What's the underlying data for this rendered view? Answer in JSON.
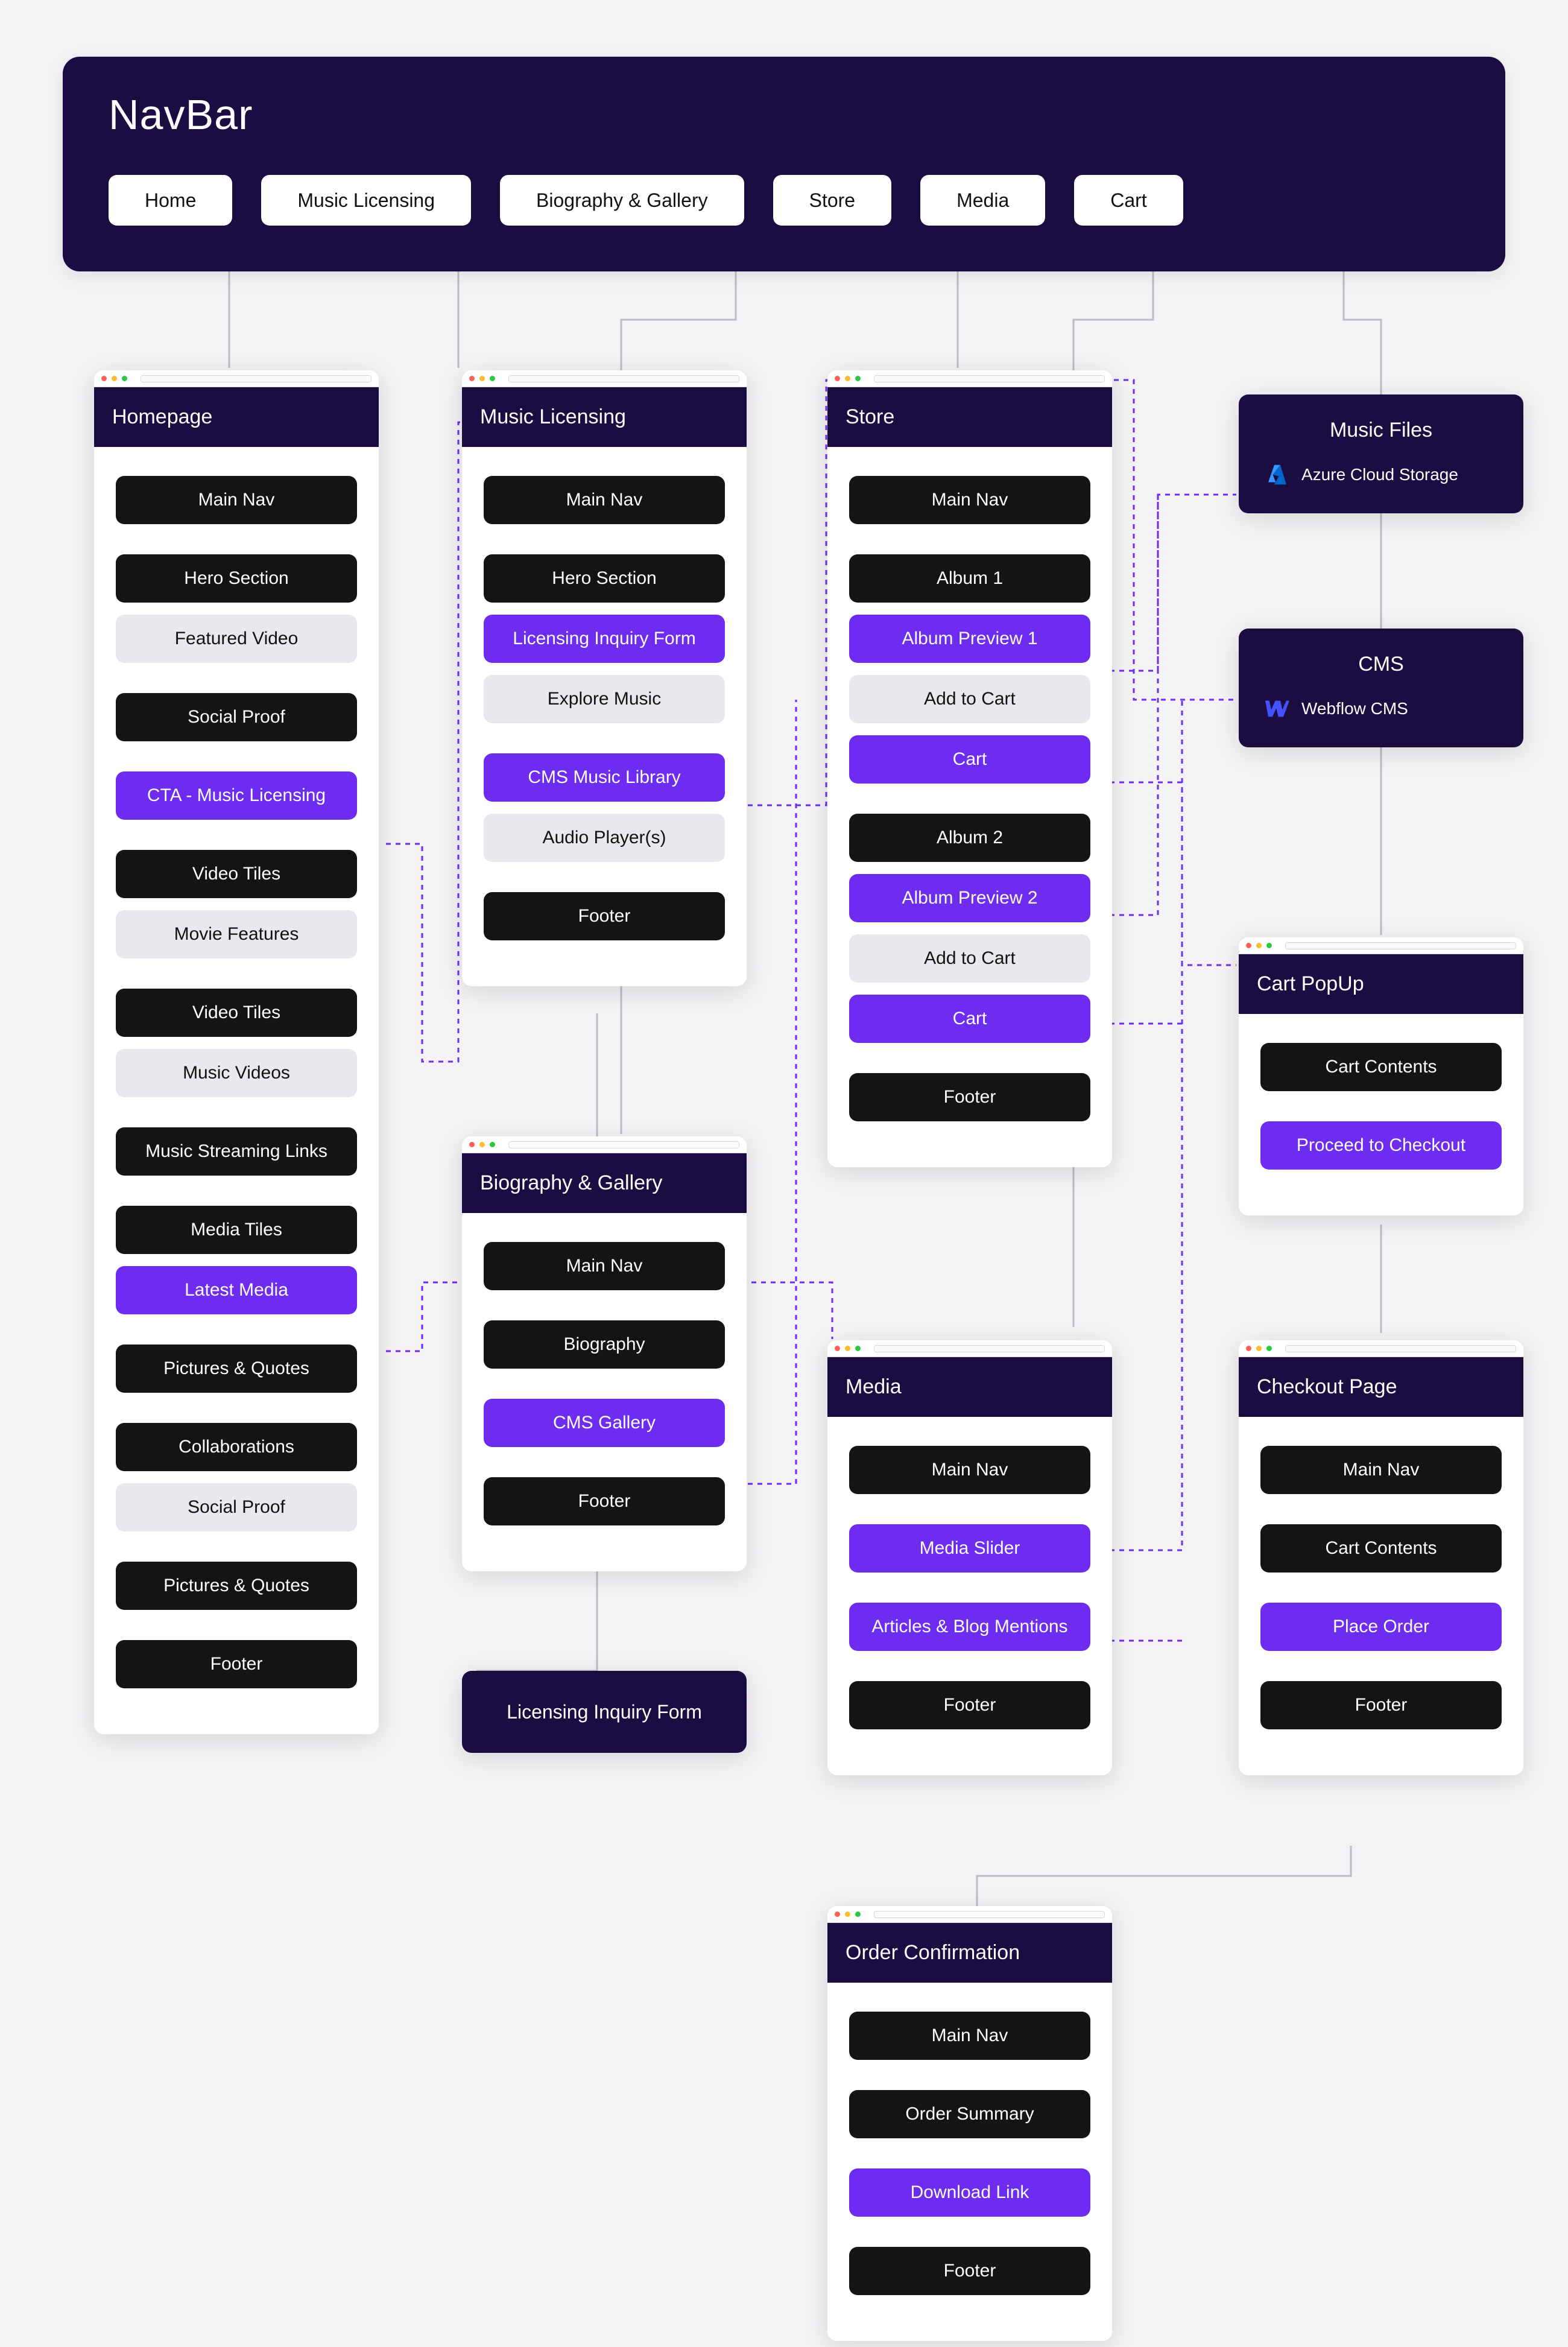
{
  "navbar": {
    "title": "NavBar",
    "items": [
      "Home",
      "Music Licensing",
      "Biography & Gallery",
      "Store",
      "Media",
      "Cart"
    ]
  },
  "homepage": {
    "title": "Homepage",
    "segments": [
      {
        "label": "Main Nav",
        "style": "black"
      },
      {
        "spacer": true
      },
      {
        "label": "Hero Section",
        "style": "black"
      },
      {
        "label": "Featured Video",
        "style": "gray"
      },
      {
        "spacer": true
      },
      {
        "label": "Social Proof",
        "style": "black"
      },
      {
        "spacer": true
      },
      {
        "label": "CTA - Music Licensing",
        "style": "purple"
      },
      {
        "spacer": true
      },
      {
        "label": "Video Tiles",
        "style": "black"
      },
      {
        "label": "Movie Features",
        "style": "gray"
      },
      {
        "spacer": true
      },
      {
        "label": "Video Tiles",
        "style": "black"
      },
      {
        "label": "Music Videos",
        "style": "gray"
      },
      {
        "spacer": true
      },
      {
        "label": "Music Streaming Links",
        "style": "black"
      },
      {
        "spacer": true
      },
      {
        "label": "Media Tiles",
        "style": "black"
      },
      {
        "label": "Latest Media",
        "style": "purple"
      },
      {
        "spacer": true
      },
      {
        "label": "Pictures & Quotes",
        "style": "black"
      },
      {
        "spacer": true
      },
      {
        "label": "Collaborations",
        "style": "black"
      },
      {
        "label": "Social Proof",
        "style": "gray"
      },
      {
        "spacer": true
      },
      {
        "label": "Pictures & Quotes",
        "style": "black"
      },
      {
        "spacer": true
      },
      {
        "label": "Footer",
        "style": "black"
      }
    ]
  },
  "licensing": {
    "title": "Music Licensing",
    "segments": [
      {
        "label": "Main Nav",
        "style": "black"
      },
      {
        "spacer": true
      },
      {
        "label": "Hero Section",
        "style": "black"
      },
      {
        "label": "Licensing Inquiry Form",
        "style": "purple"
      },
      {
        "label": "Explore Music",
        "style": "gray"
      },
      {
        "spacer": true
      },
      {
        "label": "CMS Music Library",
        "style": "purple"
      },
      {
        "label": "Audio Player(s)",
        "style": "gray"
      },
      {
        "spacer": true
      },
      {
        "label": "Footer",
        "style": "black"
      }
    ]
  },
  "biography": {
    "title": "Biography & Gallery",
    "segments": [
      {
        "label": "Main Nav",
        "style": "black"
      },
      {
        "spacer": true
      },
      {
        "label": "Biography",
        "style": "black"
      },
      {
        "spacer": true
      },
      {
        "label": "CMS Gallery",
        "style": "purple"
      },
      {
        "spacer": true
      },
      {
        "label": "Footer",
        "style": "black"
      }
    ]
  },
  "store": {
    "title": "Store",
    "segments": [
      {
        "label": "Main Nav",
        "style": "black"
      },
      {
        "spacer": true
      },
      {
        "label": "Album 1",
        "style": "black"
      },
      {
        "label": "Album Preview 1",
        "style": "purple"
      },
      {
        "label": "Add to Cart",
        "style": "gray"
      },
      {
        "label": "Cart",
        "style": "purple"
      },
      {
        "spacer": true
      },
      {
        "label": "Album 2",
        "style": "black"
      },
      {
        "label": "Album Preview 2",
        "style": "purple"
      },
      {
        "label": "Add to Cart",
        "style": "gray"
      },
      {
        "label": "Cart",
        "style": "purple"
      },
      {
        "spacer": true
      },
      {
        "label": "Footer",
        "style": "black"
      }
    ]
  },
  "media": {
    "title": "Media",
    "segments": [
      {
        "label": "Main Nav",
        "style": "black"
      },
      {
        "spacer": true
      },
      {
        "label": "Media Slider",
        "style": "purple"
      },
      {
        "spacer": true
      },
      {
        "label": "Articles & Blog Mentions",
        "style": "purple"
      },
      {
        "spacer": true
      },
      {
        "label": "Footer",
        "style": "black"
      }
    ]
  },
  "musicfiles": {
    "title": "Music Files",
    "row": {
      "icon": "azure",
      "label": "Azure Cloud Storage"
    }
  },
  "cms": {
    "title": "CMS",
    "row": {
      "icon": "webflow",
      "label": "Webflow CMS"
    }
  },
  "cartpopup": {
    "title": "Cart PopUp",
    "segments": [
      {
        "label": "Cart Contents",
        "style": "black"
      },
      {
        "spacer": true
      },
      {
        "label": "Proceed to Checkout",
        "style": "purple"
      }
    ]
  },
  "checkout": {
    "title": "Checkout Page",
    "segments": [
      {
        "label": "Main Nav",
        "style": "black"
      },
      {
        "spacer": true
      },
      {
        "label": "Cart Contents",
        "style": "black"
      },
      {
        "spacer": true
      },
      {
        "label": "Place Order",
        "style": "purple"
      },
      {
        "spacer": true
      },
      {
        "label": "Footer",
        "style": "black"
      }
    ]
  },
  "orderconf": {
    "title": "Order Confirmation",
    "segments": [
      {
        "label": "Main Nav",
        "style": "black"
      },
      {
        "spacer": true
      },
      {
        "label": "Order Summary",
        "style": "black"
      },
      {
        "spacer": true
      },
      {
        "label": "Download Link",
        "style": "purple"
      },
      {
        "spacer": true
      },
      {
        "label": "Footer",
        "style": "black"
      }
    ]
  },
  "licensing_form_block": "Licensing Inquiry Form"
}
